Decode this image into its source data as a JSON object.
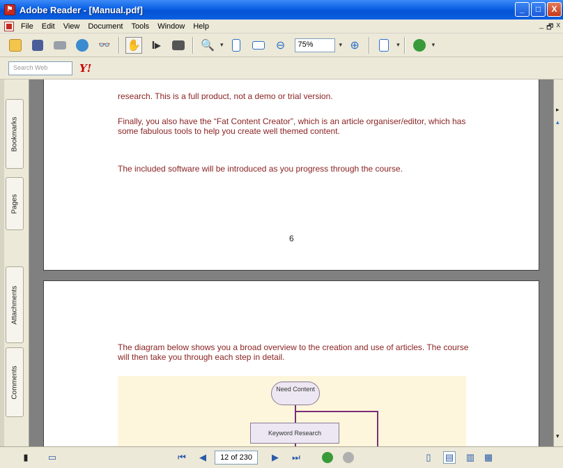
{
  "window": {
    "title": "Adobe Reader - [Manual.pdf]",
    "controls": [
      "_",
      "□",
      "X"
    ]
  },
  "menu": {
    "items": [
      "File",
      "Edit",
      "View",
      "Document",
      "Tools",
      "Window",
      "Help"
    ],
    "mdi_controls": [
      "_",
      "🗗",
      "x"
    ]
  },
  "toolbar": {
    "zoom_value": "75%"
  },
  "search": {
    "placeholder": "Search Web",
    "yahoo_label": "Y!"
  },
  "nav_tabs": [
    "Bookmarks",
    "Pages",
    "Attachments",
    "Comments"
  ],
  "document": {
    "page1": {
      "partial_line": "research.  This is a full product, not a demo or trial version.",
      "para1": "Finally, you also have the “Fat Content Creator”, which is an article organiser/editor, which has some fabulous tools to help you create well themed content.",
      "para2": "The included software will be introduced as you progress through the course.",
      "page_number": "6"
    },
    "page2": {
      "para1": "The diagram below shows you a broad overview to the creation and use of articles.  The course will then take you through each step in detail.",
      "diagram": {
        "node1": "Need Content",
        "node2": "Keyword Research"
      }
    }
  },
  "status": {
    "page_indicator": "12 of 230"
  },
  "colors": {
    "titlebar": "#0b61e5",
    "doc_text": "#8b2323",
    "chrome": "#ece9d8"
  }
}
